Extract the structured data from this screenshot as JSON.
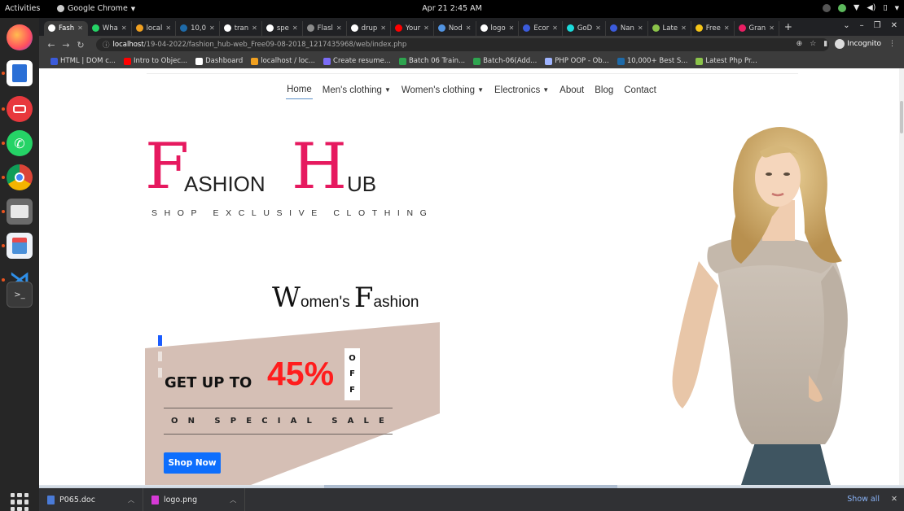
{
  "system": {
    "activities": "Activities",
    "app_name": "Google Chrome",
    "clock": "Apr 21  2:45 AM"
  },
  "tabs": [
    {
      "label": "Fash",
      "color": "#ffffff",
      "active": true
    },
    {
      "label": "Wha",
      "color": "#25d366"
    },
    {
      "label": "local",
      "color": "#f0a020"
    },
    {
      "label": "10,0",
      "color": "#1e6aa8"
    },
    {
      "label": "tran",
      "color": "#ffffff"
    },
    {
      "label": "spe",
      "color": "#ffffff"
    },
    {
      "label": "Flasl",
      "color": "#8c8c8c"
    },
    {
      "label": "drup",
      "color": "#ffffff"
    },
    {
      "label": "Your",
      "color": "#ff0000"
    },
    {
      "label": "Nod",
      "color": "#5294e2"
    },
    {
      "label": "logo",
      "color": "#ffffff"
    },
    {
      "label": "Ecor",
      "color": "#3b5bdb"
    },
    {
      "label": "GoD",
      "color": "#1bdbdb"
    },
    {
      "label": "Nan",
      "color": "#3b5bdb"
    },
    {
      "label": "Late",
      "color": "#8bc34a"
    },
    {
      "label": "Free",
      "color": "#f5c518"
    },
    {
      "label": "Gran",
      "color": "#e91e63"
    }
  ],
  "toolbar": {
    "url_host": "localhost",
    "url_path": "/19-04-2022/fashion_hub-web_Free09-08-2018_1217435968/web/index.php",
    "incognito": "Incognito"
  },
  "bookmarks": [
    {
      "label": "HTML | DOM c...",
      "color": "#3b5bdb"
    },
    {
      "label": "Intro to Objec...",
      "color": "#ff0000"
    },
    {
      "label": "Dashboard",
      "color": "#ffffff"
    },
    {
      "label": "localhost / loc...",
      "color": "#f0a020"
    },
    {
      "label": "Create resume...",
      "color": "#7b6cf6"
    },
    {
      "label": "Batch 06 Train...",
      "color": "#2ea44f"
    },
    {
      "label": "Batch-06(Add...",
      "color": "#2ea44f"
    },
    {
      "label": "PHP OOP - Ob...",
      "color": "#9fb4ff"
    },
    {
      "label": "10,000+ Best S...",
      "color": "#1e6aa8"
    },
    {
      "label": "Latest Php Pr...",
      "color": "#8bc34a"
    }
  ],
  "nav": {
    "home": "Home",
    "mens": "Men's clothing",
    "womens": "Women's clothing",
    "electronics": "Electronics",
    "about": "About",
    "blog": "Blog",
    "contact": "Contact"
  },
  "logo": {
    "big1": "F",
    "small1": "ASHION",
    "big2": "H",
    "small2": "UB",
    "tagline": "SHOP EXCLUSIVE CLOTHING"
  },
  "hero": {
    "wf_cap1": "W",
    "wf_low1": "omen's ",
    "wf_cap2": "F",
    "wf_low2": "ashion",
    "getup": "GET UP TO",
    "percent": "45%",
    "off_letters": [
      "O",
      "F",
      "F"
    ],
    "onsale_letters": [
      "O",
      "N",
      "",
      "S",
      "P",
      "E",
      "C",
      "I",
      "A",
      "L",
      "",
      "S",
      "A",
      "L",
      "E"
    ],
    "cta": "Shop Now"
  },
  "downloads": [
    {
      "name": "P065.doc",
      "color": "#4a7bd8"
    },
    {
      "name": "logo.png",
      "color": "#d63ad6"
    }
  ],
  "shelf": {
    "show_all": "Show all"
  },
  "colors": {
    "brand_pink": "#e6195f",
    "promo_red": "#ff1d1d",
    "promo_bg": "#d5bfb5",
    "cta_blue": "#0d6efd"
  }
}
